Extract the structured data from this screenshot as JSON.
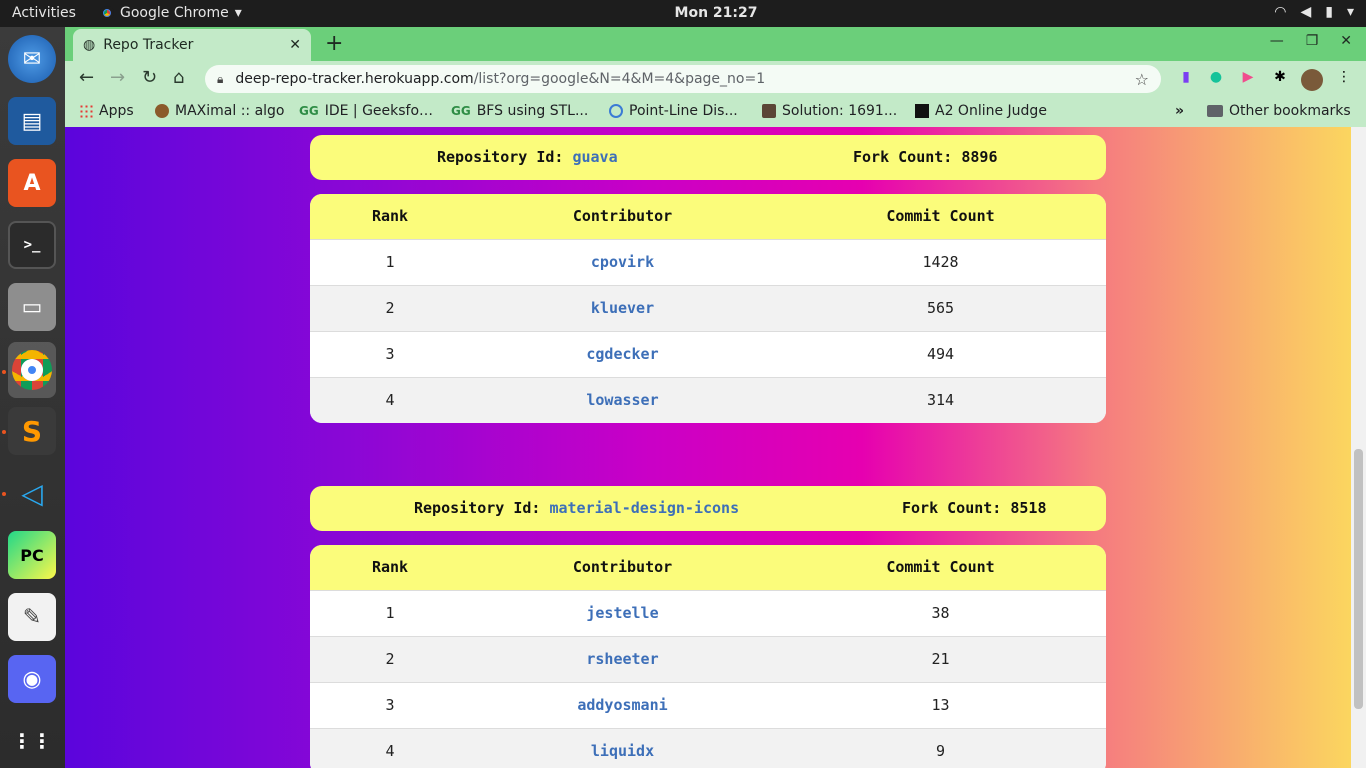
{
  "topbar": {
    "activities": "Activities",
    "app_name": "Google Chrome",
    "clock": "Mon 21:27"
  },
  "browser": {
    "tab_title": "Repo Tracker",
    "url_host": "deep-repo-tracker.herokuapp.com",
    "url_path": "/list?org=google&N=4&M=4&page_no=1",
    "bookmarks": [
      {
        "label": "Apps"
      },
      {
        "label": "MAXimal :: algo"
      },
      {
        "label": "IDE | GeeksforGeeks"
      },
      {
        "label": "BFS using STL..."
      },
      {
        "label": "Point-Line Dis..."
      },
      {
        "label": "Solution: 1691..."
      },
      {
        "label": "A2 Online Judge"
      }
    ],
    "bookmarks_more": "»",
    "other_bookmarks": "Other bookmarks"
  },
  "page": {
    "repo_id_label": "Repository Id:",
    "fork_count_label": "Fork Count:",
    "col_rank": "Rank",
    "col_contributor": "Contributor",
    "col_commits": "Commit Count",
    "repos": [
      {
        "id": "guava",
        "forks": "8896",
        "contributors": [
          {
            "rank": "1",
            "name": "cpovirk",
            "commits": "1428"
          },
          {
            "rank": "2",
            "name": "kluever",
            "commits": "565"
          },
          {
            "rank": "3",
            "name": "cgdecker",
            "commits": "494"
          },
          {
            "rank": "4",
            "name": "lowasser",
            "commits": "314"
          }
        ]
      },
      {
        "id": "material-design-icons",
        "forks": "8518",
        "contributors": [
          {
            "rank": "1",
            "name": "jestelle",
            "commits": "38"
          },
          {
            "rank": "2",
            "name": "rsheeter",
            "commits": "21"
          },
          {
            "rank": "3",
            "name": "addyosmani",
            "commits": "13"
          },
          {
            "rank": "4",
            "name": "liquidx",
            "commits": "9"
          }
        ]
      }
    ]
  },
  "colors": {
    "header_yellow": "#fbfc7b",
    "link_blue": "#3d6fb8",
    "tab_green": "#6bcf7a"
  }
}
